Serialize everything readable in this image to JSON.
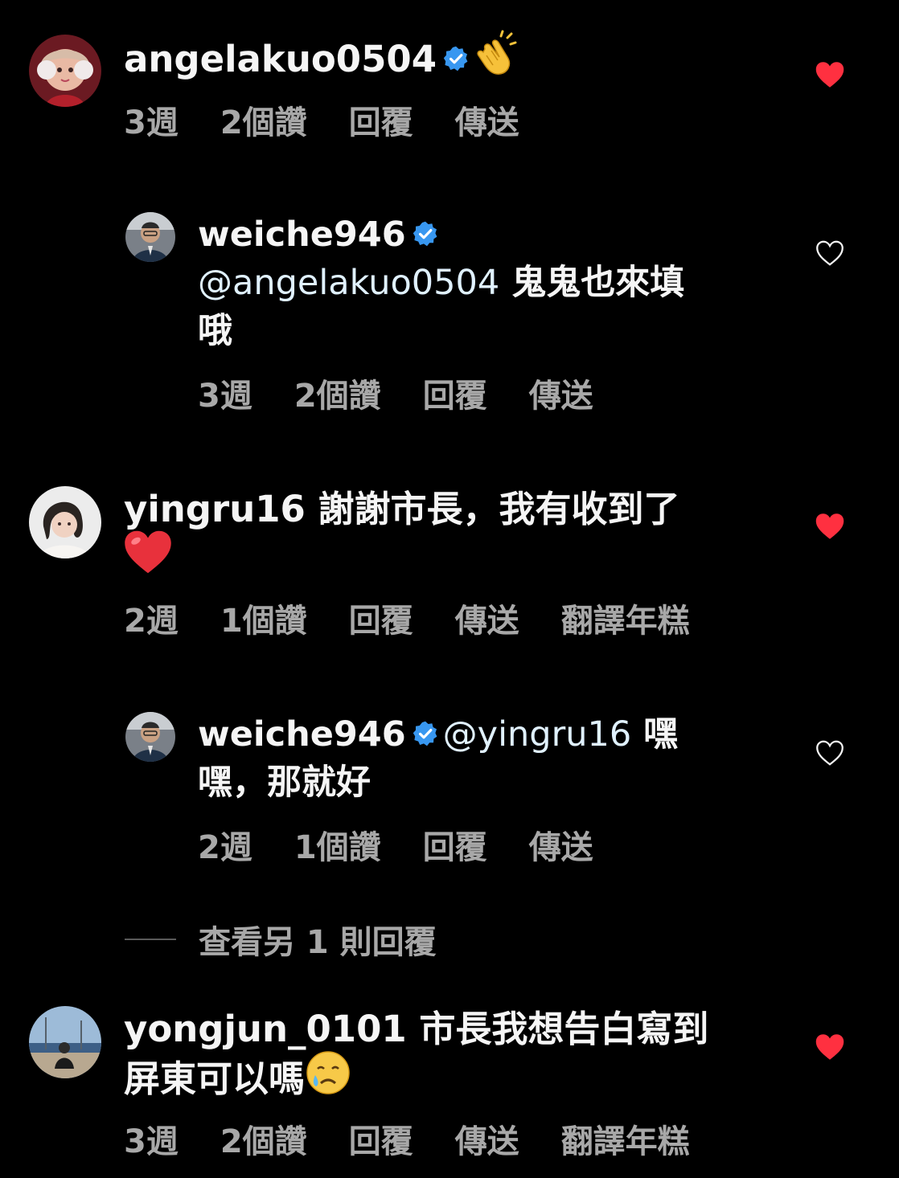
{
  "comments": [
    {
      "username": "angelakuo0504",
      "verified": true,
      "emoji": "clapping-hands",
      "text": "",
      "time": "3週",
      "likes": "2個讚",
      "reply": "回覆",
      "send": "傳送",
      "liked": true
    },
    {
      "username": "weiche946",
      "verified": true,
      "mention": "@angelakuo0504",
      "text": " 鬼鬼也來填",
      "text2": "哦",
      "time": "3週",
      "likes": "2個讚",
      "reply": "回覆",
      "send": "傳送",
      "liked": false
    },
    {
      "username": "yingru16",
      "verified": false,
      "text": " 謝謝市長，我有收到了",
      "emoji": "red-heart",
      "time": "2週",
      "likes": "1個讚",
      "reply": "回覆",
      "send": "傳送",
      "translate": "翻譯年糕",
      "liked": true
    },
    {
      "username": "weiche946",
      "verified": true,
      "mention": "@yingru16",
      "text": " 嘿",
      "text2": "嘿，那就好",
      "time": "2週",
      "likes": "1個讚",
      "reply": "回覆",
      "send": "傳送",
      "liked": false
    },
    {
      "username": "yongjun_0101",
      "verified": false,
      "text": " 市長我想告白寫到",
      "text2": "屏東可以嗎",
      "emoji": "crying-face",
      "time": "3週",
      "likes": "2個讚",
      "reply": "回覆",
      "send": "傳送",
      "translate": "翻譯年糕",
      "liked": true
    }
  ],
  "view_more": "查看另 1 則回覆",
  "colors": {
    "background": "#000000",
    "text": "#f5f5f5",
    "secondary": "#a8a8a8",
    "mention": "#e0f1ff",
    "verified": "#3897f0",
    "like": "#ff3040"
  }
}
